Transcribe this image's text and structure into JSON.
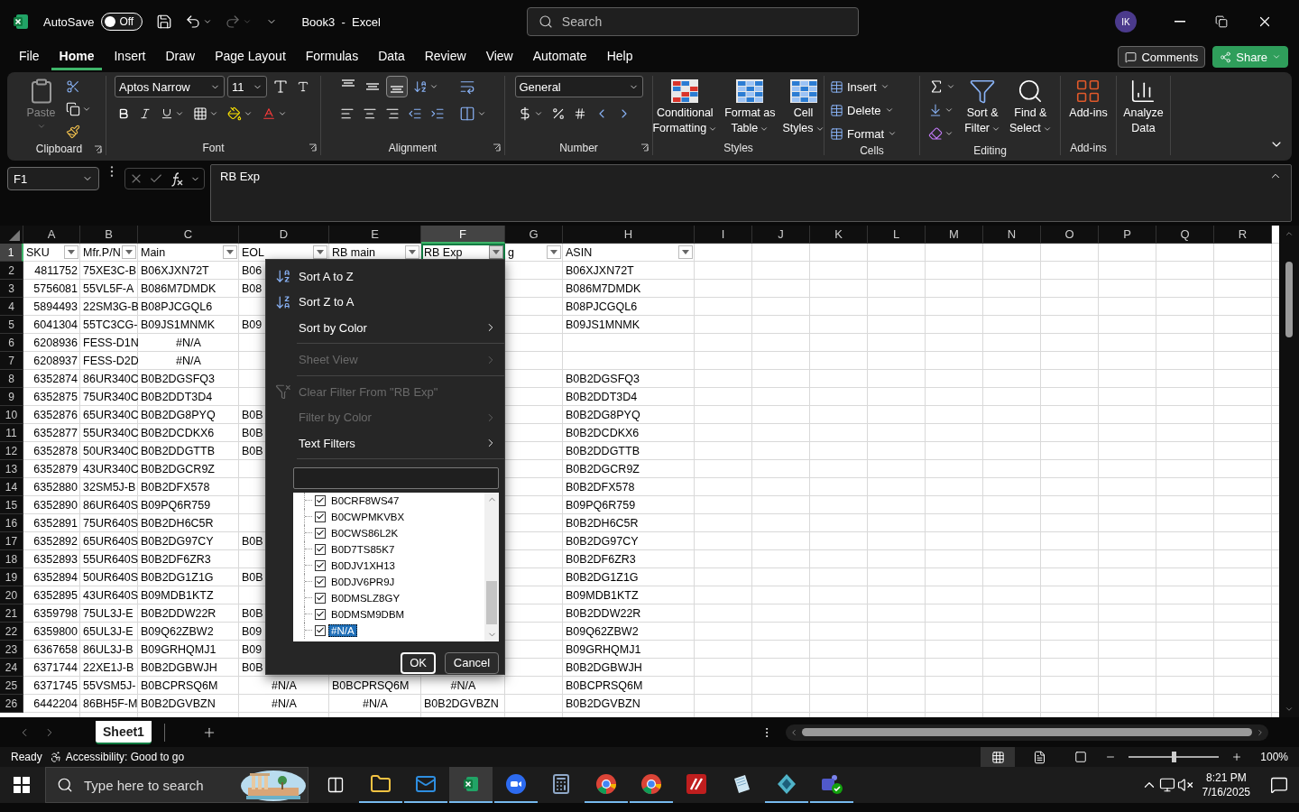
{
  "titlebar": {
    "autosave_label": "AutoSave",
    "autosave_state": "Off",
    "autosave_on": false,
    "title": "Book3  -  Excel",
    "search_placeholder": "Search",
    "avatar": "IK"
  },
  "menu_tabs": [
    {
      "label": "File",
      "selected": false
    },
    {
      "label": "Home",
      "selected": true
    },
    {
      "label": "Insert",
      "selected": false
    },
    {
      "label": "Draw",
      "selected": false
    },
    {
      "label": "Page Layout",
      "selected": false
    },
    {
      "label": "Formulas",
      "selected": false
    },
    {
      "label": "Data",
      "selected": false
    },
    {
      "label": "Review",
      "selected": false
    },
    {
      "label": "View",
      "selected": false
    },
    {
      "label": "Automate",
      "selected": false
    },
    {
      "label": "Help",
      "selected": false
    }
  ],
  "comments_button": "Comments",
  "share_button": "Share",
  "ribbon": {
    "clipboard": {
      "label": "Clipboard",
      "paste": "Paste"
    },
    "font": {
      "label": "Font",
      "font_name": "Aptos Narrow",
      "font_size": "11"
    },
    "alignment": {
      "label": "Alignment"
    },
    "number": {
      "label": "Number",
      "format": "General"
    },
    "styles": {
      "label": "Styles",
      "buttons": [
        {
          "lines": [
            "Conditional",
            "Formatting"
          ]
        },
        {
          "lines": [
            "Format as",
            "Table"
          ]
        },
        {
          "lines": [
            "Cell",
            "Styles"
          ]
        }
      ]
    },
    "cells": {
      "label": "Cells",
      "buttons": [
        "Insert",
        "Delete",
        "Format"
      ]
    },
    "editing": {
      "label": "Editing",
      "buttons": [
        {
          "lines": [
            "Sort &",
            "Filter"
          ]
        },
        {
          "lines": [
            "Find &",
            "Select"
          ]
        }
      ]
    },
    "addins": {
      "label": "Add-ins",
      "button": "Add-ins"
    },
    "analyze": {
      "lines": [
        "Analyze",
        "Data"
      ]
    }
  },
  "formula_bar": {
    "name_box": "F1",
    "formula": "RB Exp"
  },
  "columns": [
    {
      "letter": "A",
      "header": "SKU",
      "filter": true,
      "kind": "number",
      "selected": false
    },
    {
      "letter": "B",
      "header": "Mfr.P/N",
      "filter": true,
      "selected": false
    },
    {
      "letter": "C",
      "header": "Main",
      "filter": true,
      "selected": false
    },
    {
      "letter": "D",
      "header": "EOL",
      "filter": true,
      "selected": false
    },
    {
      "letter": "E",
      "header": "RB main",
      "filter": true,
      "selected": false
    },
    {
      "letter": "F",
      "header": "RB Exp",
      "filter": true,
      "selected": true
    },
    {
      "letter": "G",
      "header": "g",
      "filter": true,
      "selected": false
    },
    {
      "letter": "H",
      "header": "ASIN",
      "filter": true,
      "selected": false
    },
    {
      "letter": "I",
      "selected": false
    },
    {
      "letter": "J",
      "selected": false
    },
    {
      "letter": "K",
      "selected": false
    },
    {
      "letter": "L",
      "selected": false
    },
    {
      "letter": "M",
      "selected": false
    },
    {
      "letter": "N",
      "selected": false
    },
    {
      "letter": "O",
      "selected": false
    },
    {
      "letter": "P",
      "selected": false
    },
    {
      "letter": "Q",
      "selected": false
    },
    {
      "letter": "R",
      "selected": false
    }
  ],
  "header_row": {
    "number": "1",
    "selected": true
  },
  "rows": [
    {
      "number": "2",
      "cells": {
        "A": "4811752",
        "B": "75XE3C-B",
        "C": "B06XJXN72T",
        "D": "B06",
        "H": "B06XJXN72T"
      }
    },
    {
      "number": "3",
      "cells": {
        "A": "5756081",
        "B": "55VL5F-A",
        "C": "B086M7DMDK",
        "D": "B08",
        "H": "B086M7DMDK"
      }
    },
    {
      "number": "4",
      "cells": {
        "A": "5894493",
        "B": "22SM3G-B",
        "C": "B08PJCGQL6",
        "H": "B08PJCGQL6"
      }
    },
    {
      "number": "5",
      "cells": {
        "A": "6041304",
        "B": "55TC3CG-",
        "C": "B09JS1MNMK",
        "D": "B09",
        "H": "B09JS1MNMK"
      }
    },
    {
      "number": "6",
      "cells": {
        "A": "6208936",
        "B": "FESS-D1N",
        "C": {
          "text": "#N/A",
          "kind": "error"
        }
      }
    },
    {
      "number": "7",
      "cells": {
        "A": "6208937",
        "B": "FESS-D2D",
        "C": {
          "text": "#N/A",
          "kind": "error"
        }
      }
    },
    {
      "number": "8",
      "cells": {
        "A": "6352874",
        "B": "86UR340C",
        "C": "B0B2DGSFQ3",
        "H": "B0B2DGSFQ3"
      }
    },
    {
      "number": "9",
      "cells": {
        "A": "6352875",
        "B": "75UR340C",
        "C": "B0B2DDT3D4",
        "H": "B0B2DDT3D4"
      }
    },
    {
      "number": "10",
      "cells": {
        "A": "6352876",
        "B": "65UR340C",
        "C": "B0B2DG8PYQ",
        "D": "B0B",
        "H": "B0B2DG8PYQ"
      }
    },
    {
      "number": "11",
      "cells": {
        "A": "6352877",
        "B": "55UR340C",
        "C": "B0B2DCDKX6",
        "D": "B0B",
        "H": "B0B2DCDKX6"
      }
    },
    {
      "number": "12",
      "cells": {
        "A": "6352878",
        "B": "50UR340C",
        "C": "B0B2DDGTTB",
        "D": "B0B",
        "H": "B0B2DDGTTB"
      }
    },
    {
      "number": "13",
      "cells": {
        "A": "6352879",
        "B": "43UR340C",
        "C": "B0B2DGCR9Z",
        "H": "B0B2DGCR9Z"
      }
    },
    {
      "number": "14",
      "cells": {
        "A": "6352880",
        "B": "32SM5J-B",
        "C": "B0B2DFX578",
        "H": "B0B2DFX578"
      }
    },
    {
      "number": "15",
      "cells": {
        "A": "6352890",
        "B": "86UR640S",
        "C": "B09PQ6R759",
        "H": "B09PQ6R759"
      }
    },
    {
      "number": "16",
      "cells": {
        "A": "6352891",
        "B": "75UR640S",
        "C": "B0B2DH6C5R",
        "H": "B0B2DH6C5R"
      }
    },
    {
      "number": "17",
      "cells": {
        "A": "6352892",
        "B": "65UR640S",
        "C": "B0B2DG97CY",
        "D": "B0B",
        "H": "B0B2DG97CY"
      }
    },
    {
      "number": "18",
      "cells": {
        "A": "6352893",
        "B": "55UR640S",
        "C": "B0B2DF6ZR3",
        "H": "B0B2DF6ZR3"
      }
    },
    {
      "number": "19",
      "cells": {
        "A": "6352894",
        "B": "50UR640S",
        "C": "B0B2DG1Z1G",
        "D": "B0B",
        "H": "B0B2DG1Z1G"
      }
    },
    {
      "number": "20",
      "cells": {
        "A": "6352895",
        "B": "43UR640S",
        "C": "B09MDB1KTZ",
        "H": "B09MDB1KTZ"
      }
    },
    {
      "number": "21",
      "cells": {
        "A": "6359798",
        "B": "75UL3J-E",
        "C": "B0B2DDW22R",
        "D": "B0B",
        "H": "B0B2DDW22R"
      }
    },
    {
      "number": "22",
      "cells": {
        "A": "6359800",
        "B": "65UL3J-E",
        "C": "B09Q62ZBW2",
        "D": "B09",
        "H": "B09Q62ZBW2"
      }
    },
    {
      "number": "23",
      "cells": {
        "A": "6367658",
        "B": "86UL3J-B",
        "C": "B09GRHQMJ1",
        "D": "B09",
        "H": "B09GRHQMJ1"
      }
    },
    {
      "number": "24",
      "cells": {
        "A": "6371744",
        "B": "22XE1J-B",
        "C": "B0B2DGBWJH",
        "D": "B0B",
        "H": "B0B2DGBWJH"
      }
    },
    {
      "number": "25",
      "cells": {
        "A": "6371745",
        "B": "55VSM5J-",
        "C": "B0BCPRSQ6M",
        "D": {
          "text": "#N/A",
          "kind": "error"
        },
        "E": "B0BCPRSQ6M",
        "F": {
          "text": "#N/A",
          "kind": "error"
        },
        "H": "B0BCPRSQ6M"
      }
    },
    {
      "number": "26",
      "cells": {
        "A": "6442204",
        "B": "86BH5F-M",
        "C": "B0B2DGVBZN",
        "D": {
          "text": "#N/A",
          "kind": "error"
        },
        "E": {
          "text": "#N/A",
          "kind": "error"
        },
        "F": "B0B2DGVBZN",
        "H": "B0B2DGVBZN"
      }
    }
  ],
  "filter_menu": {
    "items": [
      {
        "kind": "sort_ascending",
        "label": "Sort A to Z",
        "disabled": false
      },
      {
        "kind": "sort_descending",
        "label": "Sort Z to A",
        "disabled": false
      },
      {
        "kind": "submenu",
        "label": "Sort by Color",
        "disabled": false
      },
      {
        "kind": "divider"
      },
      {
        "kind": "submenu",
        "label": "Sheet View",
        "disabled": true
      },
      {
        "kind": "divider"
      },
      {
        "kind": "clear_filter",
        "label": "Clear Filter From \"RB Exp\"",
        "disabled": true
      },
      {
        "kind": "submenu",
        "label": "Filter by Color",
        "disabled": true
      },
      {
        "kind": "submenu",
        "label": "Text Filters",
        "disabled": false
      }
    ],
    "values": [
      {
        "label": "B0CRF8WS47",
        "checked": true,
        "selected": false
      },
      {
        "label": "B0CWPMKVBX",
        "checked": true,
        "selected": false
      },
      {
        "label": "B0CWS86L2K",
        "checked": true,
        "selected": false
      },
      {
        "label": "B0D7TS85K7",
        "checked": true,
        "selected": false
      },
      {
        "label": "B0DJV1XH13",
        "checked": true,
        "selected": false
      },
      {
        "label": "B0DJV6PR9J",
        "checked": true,
        "selected": false
      },
      {
        "label": "B0DMSLZ8GY",
        "checked": true,
        "selected": false
      },
      {
        "label": "B0DMSM9DBM",
        "checked": true,
        "selected": false
      },
      {
        "label": "#N/A",
        "checked": true,
        "selected": true
      }
    ],
    "ok": "OK",
    "cancel": "Cancel"
  },
  "sheet_tabs": [
    {
      "label": "Sheet1",
      "selected": true
    }
  ],
  "status_bar": {
    "mode": "Ready",
    "accessibility": "Accessibility: Good to go",
    "views": [
      {
        "kind": "normal",
        "selected": true
      },
      {
        "kind": "page_layout",
        "selected": false
      },
      {
        "kind": "page_break",
        "selected": false
      }
    ],
    "zoom": {
      "level": 0.5
    },
    "zoom_label": "100%"
  },
  "taskbar": {
    "search_placeholder": "Type here to search",
    "apps": [
      {
        "kind": "explorer",
        "open": true,
        "selected": false
      },
      {
        "kind": "outlook",
        "open": true,
        "selected": false
      },
      {
        "kind": "excel",
        "open": true,
        "selected": true
      },
      {
        "kind": "zoom",
        "open": true,
        "selected": false
      },
      {
        "kind": "calculator",
        "open": false,
        "selected": false
      },
      {
        "kind": "chrome",
        "open": true,
        "selected": false
      },
      {
        "kind": "chrome",
        "open": true,
        "selected": false
      },
      {
        "kind": "filezilla",
        "open": false,
        "selected": false
      },
      {
        "kind": "notepad",
        "open": false,
        "selected": false
      },
      {
        "kind": "diamond",
        "open": true,
        "selected": false
      },
      {
        "kind": "teams",
        "open": true,
        "selected": false
      }
    ],
    "time": "8:21 PM",
    "date": "7/16/2025"
  }
}
